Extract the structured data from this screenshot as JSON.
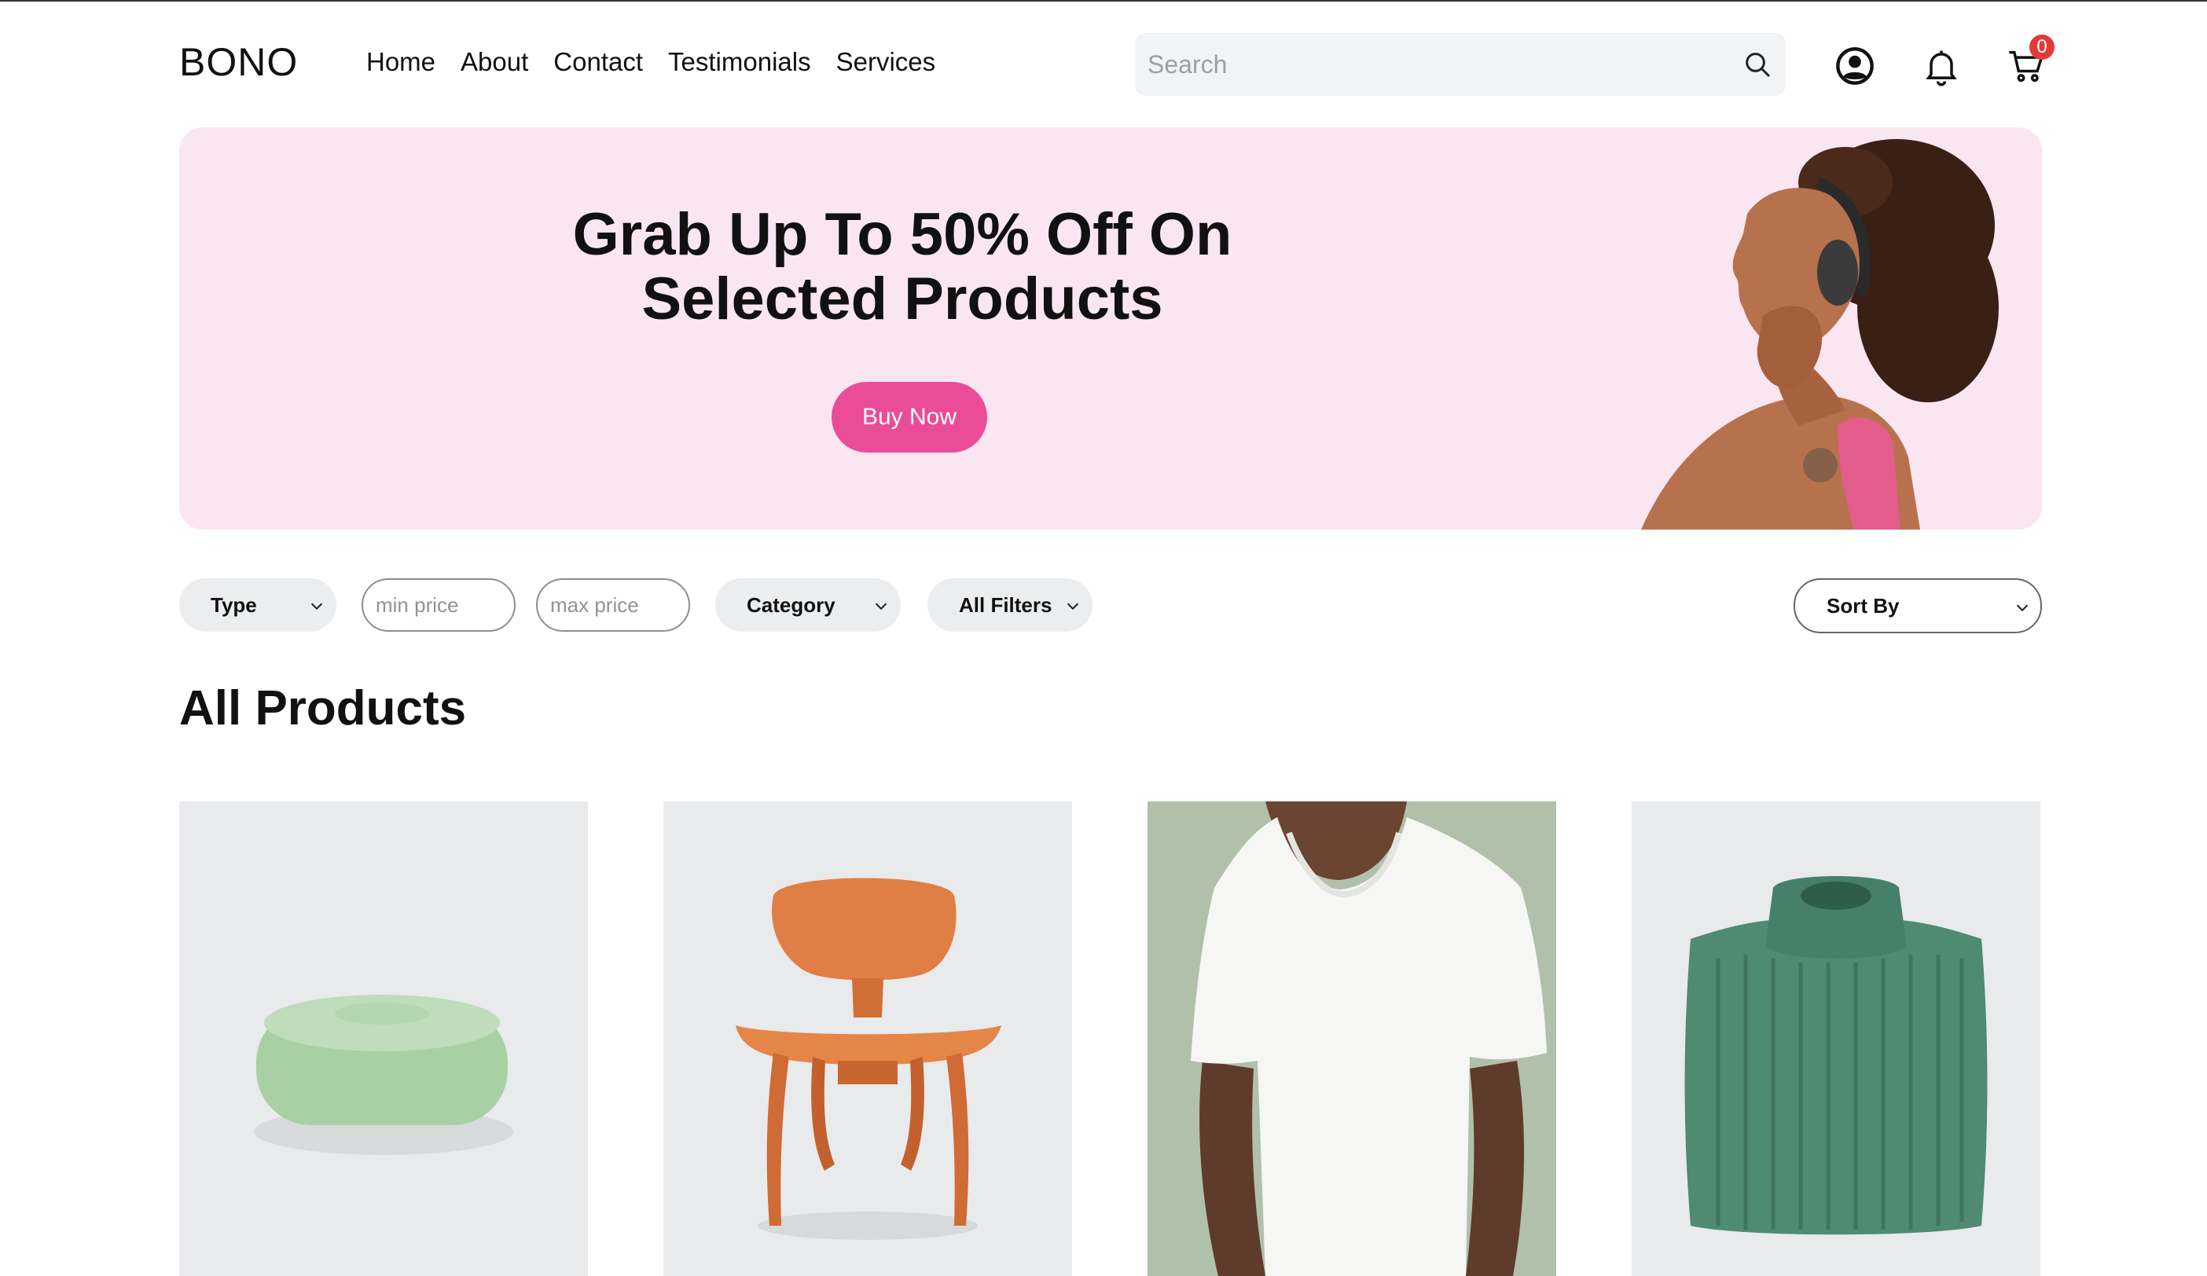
{
  "header": {
    "logo": "BONO",
    "nav": [
      "Home",
      "About",
      "Contact",
      "Testimonials",
      "Services"
    ],
    "search_placeholder": "Search",
    "cart_count": "0",
    "icons": [
      "search-icon",
      "user-icon",
      "bell-icon",
      "cart-icon"
    ]
  },
  "hero": {
    "title_line1": "Grab Up To 50% Off On",
    "title_line2": "Selected Products",
    "button": "Buy Now",
    "background": "#fae6f1",
    "button_color": "#ea4c98"
  },
  "filters": {
    "type": "Type",
    "min_price_placeholder": "min price",
    "max_price_placeholder": "max price",
    "category": "Category",
    "all_filters": "All Filters",
    "sort_by": "Sort By"
  },
  "products": {
    "title": "All Products",
    "items": [
      {
        "image": "green-pouf-image"
      },
      {
        "image": "orange-wooden-chair-image"
      },
      {
        "image": "white-tshirt-model-image"
      },
      {
        "image": "green-knit-sweater-image"
      }
    ]
  }
}
